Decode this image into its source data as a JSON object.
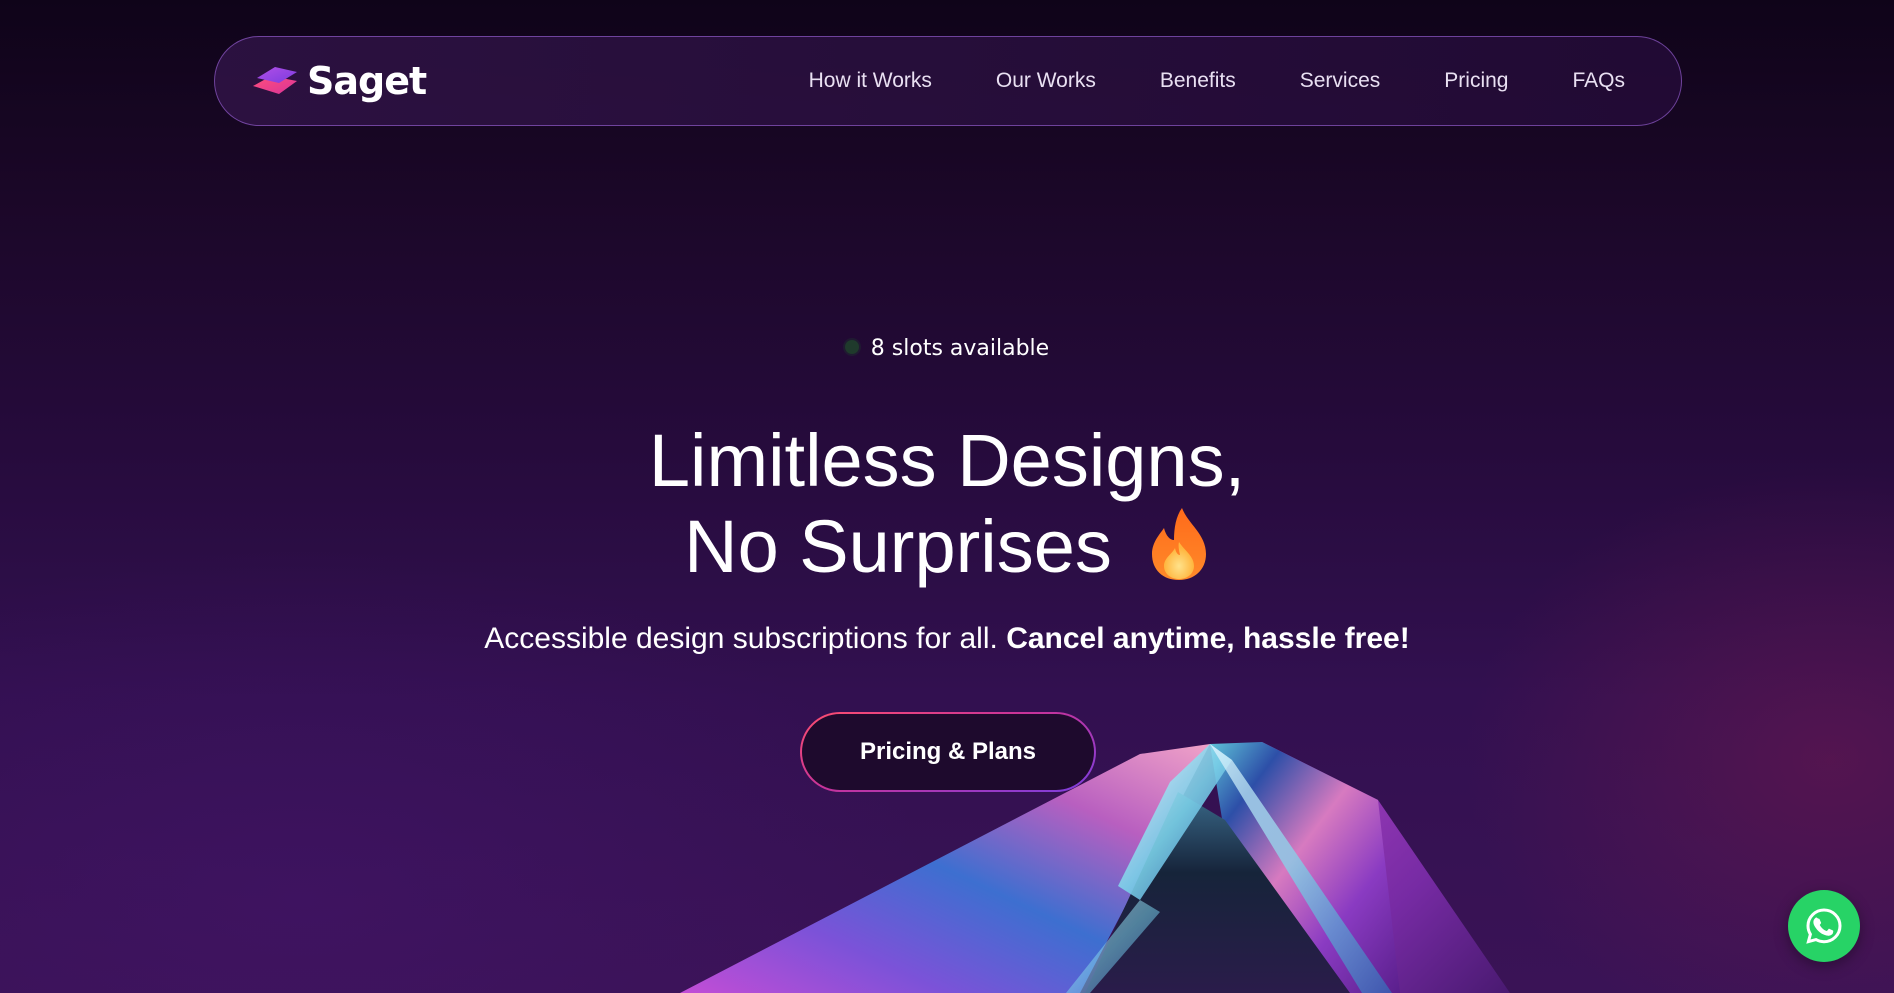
{
  "brand": {
    "name": "Saget",
    "logo_icon": "stacked-diamond-logo-icon"
  },
  "nav": {
    "links": [
      {
        "label": "How it Works"
      },
      {
        "label": "Our Works"
      },
      {
        "label": "Benefits"
      },
      {
        "label": "Services"
      },
      {
        "label": "Pricing"
      },
      {
        "label": "FAQs"
      }
    ]
  },
  "hero": {
    "slots_text": "8 slots available",
    "title_line1": "Limitless Designs,",
    "title_line2": "No Surprises",
    "title_icon": "flame-icon",
    "subtitle_regular": "Accessible design subscriptions for all.",
    "subtitle_bold": "Cancel anytime, hassle free!",
    "cta_label": "Pricing & Plans"
  },
  "floating": {
    "whatsapp_icon": "whatsapp-icon"
  },
  "colors": {
    "background_top": "#0f0419",
    "background_bottom": "#3a1356",
    "nav_border": "#965fd2",
    "cta_border_start": "#ff4f6e",
    "cta_border_end": "#7b3ee0",
    "whatsapp_green": "#27d366",
    "slots_dot": "#1f3a2c"
  }
}
